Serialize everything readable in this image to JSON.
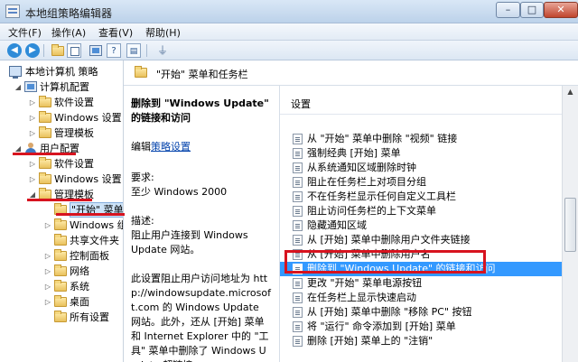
{
  "window": {
    "title": "本地组策略编辑器",
    "controls": {
      "minimize": "–",
      "maximize": "□",
      "close": "✕"
    }
  },
  "menubar": {
    "items": [
      "文件(F)",
      "操作(A)",
      "查看(V)",
      "帮助(H)"
    ]
  },
  "toolbar": {
    "icons": [
      "back-icon",
      "forward-icon",
      "up-folder-icon",
      "show-tree-icon",
      "export-list-icon",
      "help-icon",
      "properties-icon",
      "filter-icon"
    ],
    "help_glyph": "?",
    "props_glyph": "▤",
    "back_glyph": "◀",
    "forward_glyph": "▶",
    "filter_glyph": "⏚"
  },
  "tree": {
    "root": "本地计算机 策略",
    "computer_config": "计算机配置",
    "computer_children": [
      "软件设置",
      "Windows 设置",
      "管理模板"
    ],
    "user_config": "用户配置",
    "user_children": [
      "软件设置",
      "Windows 设置",
      "管理模板"
    ],
    "admin_children": [
      "\"开始\" 菜单",
      "Windows 组",
      "共享文件夹",
      "控制面板",
      "网络",
      "系统",
      "桌面",
      "所有设置"
    ]
  },
  "extended": {
    "folder_title": "\"开始\" 菜单和任务栏",
    "policy_title": "删除到 \"Windows Update\" 的链接和访问",
    "edit_prefix": "编辑",
    "edit_link": "策略设置",
    "req_label": "要求:",
    "req_value": "至少 Windows 2000",
    "desc_label": "描述:",
    "desc_text": "阻止用户连接到 Windows Update 网站。",
    "desc_more": "此设置阻止用户访问地址为 http://windowsupdate.microsoft.com 的 Windows Update 网站。此外，还从 [开始] 菜单和 Internet Explorer 中的 \"工具\" 菜单中删除了 Windows Update 超链接。"
  },
  "list": {
    "header": "设置",
    "rows": [
      "从 \"开始\" 菜单中删除 \"视频\" 链接",
      "强制经典 [开始] 菜单",
      "从系统通知区域删除时钟",
      "阻止在任务栏上对项目分组",
      "不在任务栏显示任何自定义工具栏",
      "阻止访问任务栏的上下文菜单",
      "隐藏通知区域",
      "从 [开始] 菜单中删除用户文件夹链接",
      "从 [开始] 菜单中删除用户名",
      "删除到 \"Windows Update\" 的链接和访问",
      "更改 \"开始\" 菜单电源按钮",
      "在任务栏上显示快速启动",
      "从 [开始] 菜单中删除 \"移除 PC\" 按钮",
      "将 \"运行\" 命令添加到 [开始] 菜单",
      "删除 [开始] 菜单上的 \"注销\""
    ],
    "selected_index": 9
  },
  "annotation_color": "#d7131f"
}
